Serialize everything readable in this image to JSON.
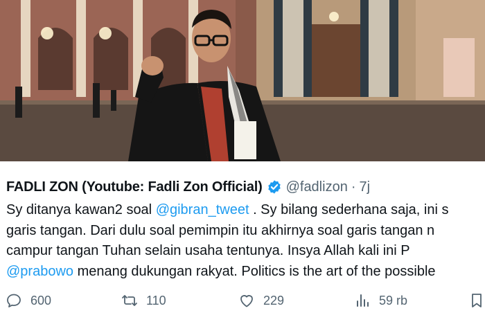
{
  "tweet": {
    "display_name": "FADLI ZON (Youtube: Fadli Zon Official)",
    "handle": "@fadlizon",
    "separator": "·",
    "time": "7j",
    "body": {
      "line1_a": "Sy ditanya kawan2 soal ",
      "line1_mention": "@gibran_tweet",
      "line1_b": " . Sy bilang sederhana saja, ini s",
      "line2": "garis tangan. Dari dulu soal pemimpin itu akhirnya soal garis tangan n",
      "line3": "campur tangan Tuhan selain usaha tentunya. Insya Allah kali ini P",
      "line4_mention": "@prabowo",
      "line4_b": " menang dukungan rakyat. Politics is the art of the possible"
    }
  },
  "actions": {
    "reply_count": "600",
    "retweet_count": "110",
    "like_count": "229",
    "views_count": "59 rb"
  },
  "icons": {
    "verified": "verified-badge-icon",
    "reply": "reply-icon",
    "retweet": "retweet-icon",
    "like": "heart-icon",
    "views": "views-bar-chart-icon",
    "bookmark": "bookmark-icon"
  },
  "colors": {
    "text": "#0f1419",
    "secondary": "#536471",
    "link": "#1d9bf0",
    "verified": "#1d9bf0"
  }
}
